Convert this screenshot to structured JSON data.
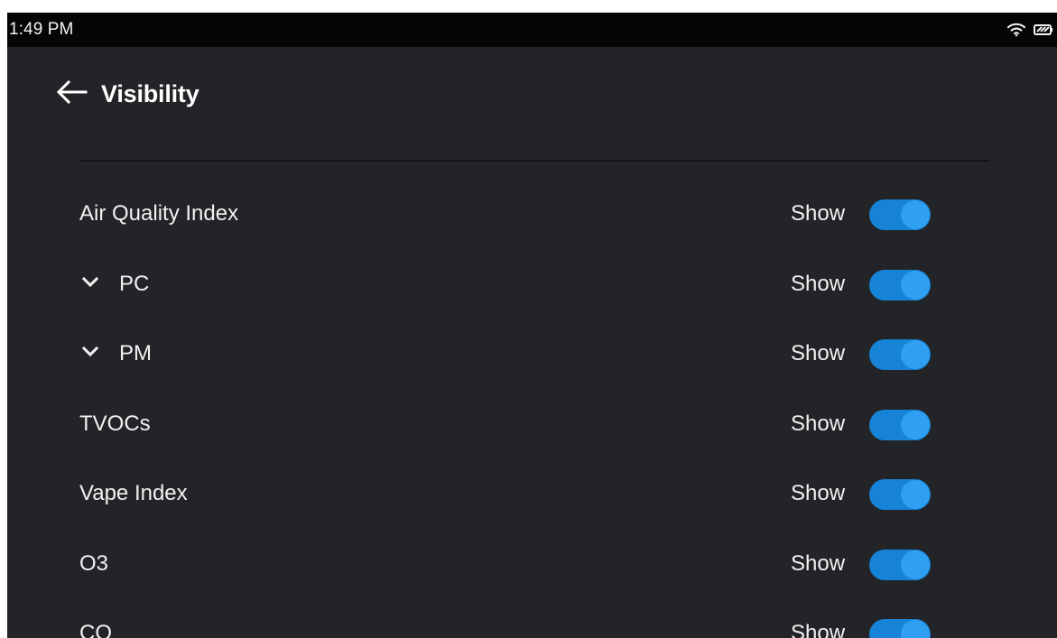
{
  "status_bar": {
    "time": "1:49 PM",
    "icons": [
      "wifi-icon",
      "battery-icon"
    ]
  },
  "header": {
    "back_icon": "arrow-left-icon",
    "title": "Visibility"
  },
  "settings": {
    "rows": [
      {
        "label": "Air Quality Index",
        "expand_icon": "",
        "show_label": "Show",
        "enabled": true
      },
      {
        "label": "PC",
        "expand_icon": "chevron-down-icon",
        "show_label": "Show",
        "enabled": true
      },
      {
        "label": "PM",
        "expand_icon": "chevron-down-icon",
        "show_label": "Show",
        "enabled": true
      },
      {
        "label": "TVOCs",
        "expand_icon": "",
        "show_label": "Show",
        "enabled": true
      },
      {
        "label": "Vape Index",
        "expand_icon": "",
        "show_label": "Show",
        "enabled": true
      },
      {
        "label": "O3",
        "expand_icon": "",
        "show_label": "Show",
        "enabled": true
      },
      {
        "label": "CO",
        "expand_icon": "",
        "show_label": "Show",
        "enabled": true
      }
    ]
  },
  "colors": {
    "screen_background": "#232427",
    "status_bar_background": "#050505",
    "text": "#f1f1f1",
    "toggle_track": "#1683d6",
    "toggle_thumb": "#2f9ff2"
  }
}
